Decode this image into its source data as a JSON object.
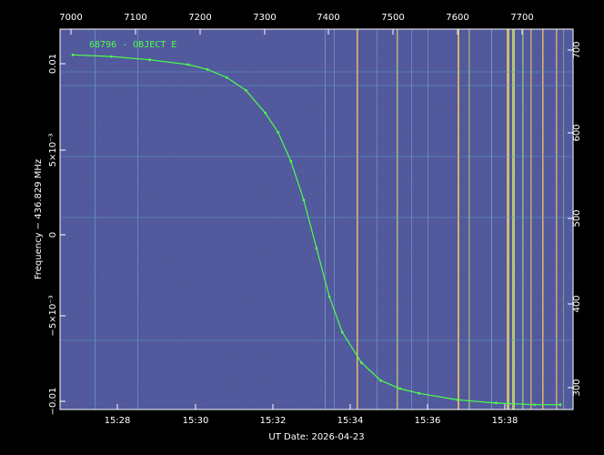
{
  "chart_data": {
    "type": "line",
    "series": [
      {
        "name": "68796 - OBJECT E",
        "x_time": [
          "15:27:00",
          "15:28:00",
          "15:29:00",
          "15:30:00",
          "15:30:30",
          "15:31:00",
          "15:31:30",
          "15:32:00",
          "15:32:20",
          "15:32:40",
          "15:33:00",
          "15:33:20",
          "15:33:40",
          "15:34:00",
          "15:34:30",
          "15:35:00",
          "15:35:30",
          "15:36:00",
          "15:37:00",
          "15:38:00",
          "15:39:00",
          "15:39:40"
        ],
        "values": [
          0.0108,
          0.0107,
          0.0105,
          0.0102,
          0.0099,
          0.0094,
          0.0086,
          0.0072,
          0.006,
          0.0042,
          0.0018,
          -0.0012,
          -0.0042,
          -0.0064,
          -0.0083,
          -0.0094,
          -0.0099,
          -0.0102,
          -0.0106,
          -0.0108,
          -0.0109,
          -0.0109
        ]
      }
    ],
    "xlabel": "UT Date: 2026-04-23",
    "ylabel": "Frequency − 436.829 MHz",
    "x_bottom_ticks": [
      "15:28",
      "15:30",
      "15:32",
      "15:34",
      "15:36",
      "15:38"
    ],
    "x_top_ticks": [
      "7000",
      "7100",
      "7200",
      "7300",
      "7400",
      "7500",
      "7600",
      "7700"
    ],
    "y_left_ticks": [
      "−0.01",
      "−5×10⁻³",
      "0",
      "5×10⁻³",
      "0.01"
    ],
    "y_right_ticks": [
      "300",
      "400",
      "500",
      "600",
      "700"
    ],
    "x_range": [
      "15:26:40",
      "15:40:00"
    ],
    "y_range": [
      -0.0112,
      0.0124
    ],
    "colors": {
      "background": "#000000",
      "waterfall": "#3b3f8a",
      "track": "#4cff4c",
      "axes": "#ffffff"
    }
  }
}
